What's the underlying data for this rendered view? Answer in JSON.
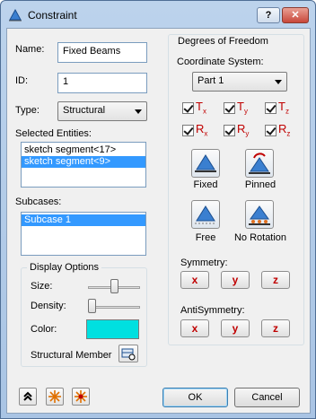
{
  "window": {
    "title": "Constraint",
    "help_label": "?",
    "close_label": "✕"
  },
  "left": {
    "name_label": "Name:",
    "name_value": "Fixed Beams",
    "id_label": "ID:",
    "id_value": "1",
    "type_label": "Type:",
    "type_value": "Structural",
    "selected_label": "Selected Entities:",
    "selected_items": [
      "sketch segment<17>",
      "sketch segment<9>"
    ],
    "subcases_label": "Subcases:",
    "subcases_items": [
      "Subcase 1"
    ],
    "display_options": {
      "title": "Display Options",
      "size_label": "Size:",
      "size_level": 0.5,
      "density_label": "Density:",
      "density_level": 0.0,
      "color_label": "Color:",
      "color_value": "#00e0e0",
      "structural_member_label": "Structural Member"
    }
  },
  "right": {
    "title": "Degrees of Freedom",
    "coord_label": "Coordinate System:",
    "coord_value": "Part 1",
    "dof_main": [
      "T",
      "T",
      "T",
      "R",
      "R",
      "R"
    ],
    "dof_subs": [
      "x",
      "y",
      "z",
      "x",
      "y",
      "z"
    ],
    "presets": [
      "Fixed",
      "Pinned",
      "Free",
      "No Rotation"
    ],
    "symmetry_label": "Symmetry:",
    "antisymmetry_label": "AntiSymmetry:",
    "axes": [
      "x",
      "y",
      "z"
    ]
  },
  "footer": {
    "ok_label": "OK",
    "cancel_label": "Cancel"
  },
  "colors": {
    "accent": "#3399ff",
    "dof": "#c00000",
    "swatch": "#00e0e0"
  }
}
